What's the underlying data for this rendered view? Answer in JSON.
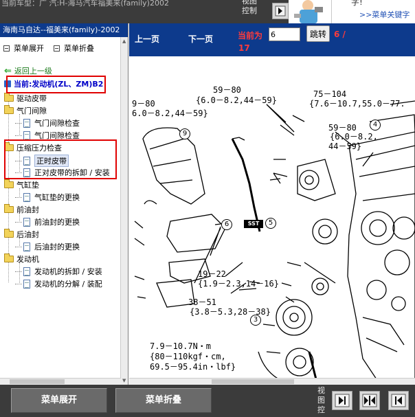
{
  "top_bar": {
    "title": "当前车型：广 汽:H-海马汽车福美来(family)2002",
    "view_control": "视图控制",
    "top_right_char": "字!",
    "keyword_link": ">>菜单关键字"
  },
  "left_panel": {
    "title": "海南马自达--福美来(family)-2002",
    "expand_menu": "菜单展开",
    "collapse_menu": "菜单折叠",
    "back_link": "返回上一级",
    "current": "当前:发动机(ZL、ZM)B2",
    "tree": [
      {
        "type": "folder",
        "label": "驱动皮带"
      },
      {
        "type": "folder",
        "label": "气门间隙"
      },
      {
        "type": "doc",
        "label": "气门间隙检查"
      },
      {
        "type": "doc",
        "label": "气门间隙检查"
      },
      {
        "type": "folder",
        "label": "压缩压力检查"
      },
      {
        "type": "doc",
        "label": "正时皮带",
        "selected": true
      },
      {
        "type": "doc",
        "label": "正对皮带的拆卸 / 安装"
      },
      {
        "type": "folder",
        "label": "气缸垫"
      },
      {
        "type": "doc",
        "label": "气缸垫的更换"
      },
      {
        "type": "folder",
        "label": "前油封"
      },
      {
        "type": "doc",
        "label": "前油封的更换"
      },
      {
        "type": "folder",
        "label": "后油封"
      },
      {
        "type": "doc",
        "label": "后油封的更换"
      },
      {
        "type": "folder",
        "label": "发动机"
      },
      {
        "type": "doc",
        "label": "发动机的拆卸 / 安装"
      },
      {
        "type": "doc",
        "label": "发动机的分解 / 装配"
      }
    ]
  },
  "toolbar": {
    "prev_page": "上一页",
    "next_page": "下一页",
    "current_label": "当前为",
    "page_value": "6",
    "jump_button": "跳转",
    "page_total": "6 /",
    "page_total_2": "17"
  },
  "diagram": {
    "labels": {
      "l1": "59－80",
      "l2": "{6.0－8.2,44－59}",
      "l3": "9－80",
      "l4": "6.0－8.2,44－59}",
      "l5": "75－104",
      "l6": "{7.6－10.7,55.0－77.",
      "l7": "59－80",
      "l8": "{6.0－8.2,",
      "l9": "44－59}",
      "l10": "19－22",
      "l11": "{1.9－2.3,14－16}",
      "l12": "38－51",
      "l13": "{3.8－5.3,28－38}",
      "l14": "7.9－10.7N・m",
      "l15": "{80－110kgf・cm,",
      "l16": "69.5－95.4in・lbf}",
      "sst": "SST"
    },
    "callouts": {
      "c9": "9",
      "c6": "6",
      "c5": "5",
      "c4": "4",
      "c3": "3"
    }
  },
  "bottom_bar": {
    "expand_button": "菜单展开",
    "collapse_button": "菜单折叠",
    "view_control": "视图控"
  },
  "colors": {
    "nav_blue": "#0d3a8c",
    "dark_bar": "#3b3b3b",
    "highlight_red": "#e00000",
    "page_red": "#ff3b3b"
  }
}
